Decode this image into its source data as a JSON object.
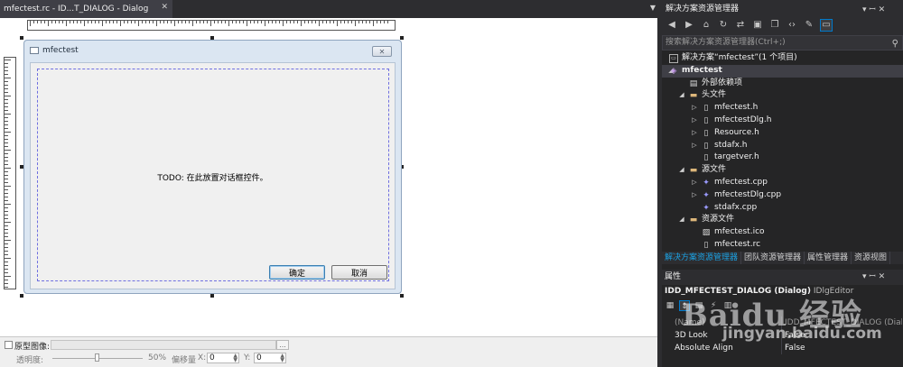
{
  "document": {
    "tab_title": "mfectest.rc - ID...T_DIALOG - Dialog",
    "close_glyph": "✕",
    "dropdown_glyph": "▼"
  },
  "dialog": {
    "title": "mfectest",
    "close_glyph": "✕",
    "todo_text": "TODO: 在此放置对话框控件。",
    "ok_label": "确定",
    "cancel_label": "取消"
  },
  "bottom_bar": {
    "prototype_label": "原型图像:",
    "browse_label": "...",
    "transparency_label": "透明度:",
    "transparency_value": "50%",
    "offset_label": "偏移量",
    "x_label": "X:",
    "x_value": "0",
    "y_label": "Y:",
    "y_value": "0"
  },
  "solution_explorer": {
    "title": "解决方案资源管理器",
    "pin_glyph": "▾ ꟷ ✕",
    "search_placeholder": "搜索解决方案资源管理器(Ctrl+;)",
    "search_icon": "search-icon",
    "toolbar_icons": [
      "back-icon",
      "forward-icon",
      "home-icon",
      "sync-icon",
      "refresh-icon",
      "collapse-all-icon",
      "show-all-files-icon",
      "code-view-icon",
      "properties-icon",
      "preview-icon"
    ],
    "tree": [
      {
        "label": "解决方案“mfectest”(1 个项目)",
        "icon": "solution-icon",
        "depth": 0,
        "expander": ""
      },
      {
        "label": "mfectest",
        "icon": "project-icon",
        "depth": 0,
        "expander": "◢",
        "bold": true,
        "selected": true
      },
      {
        "label": "外部依赖项",
        "icon": "external-deps-icon",
        "depth": 1,
        "expander": ""
      },
      {
        "label": "头文件",
        "icon": "folder-icon",
        "depth": 1,
        "expander": "◢"
      },
      {
        "label": "mfectest.h",
        "icon": "header-file-icon",
        "depth": 2,
        "expander": "▷"
      },
      {
        "label": "mfectestDlg.h",
        "icon": "header-file-icon",
        "depth": 2,
        "expander": "▷"
      },
      {
        "label": "Resource.h",
        "icon": "header-file-icon",
        "depth": 2,
        "expander": "▷"
      },
      {
        "label": "stdafx.h",
        "icon": "header-file-icon",
        "depth": 2,
        "expander": "▷"
      },
      {
        "label": "targetver.h",
        "icon": "header-file-icon",
        "depth": 2,
        "expander": ""
      },
      {
        "label": "源文件",
        "icon": "folder-icon",
        "depth": 1,
        "expander": "◢"
      },
      {
        "label": "mfectest.cpp",
        "icon": "cpp-file-icon",
        "depth": 2,
        "expander": "▷"
      },
      {
        "label": "mfectestDlg.cpp",
        "icon": "cpp-file-icon",
        "depth": 2,
        "expander": "▷"
      },
      {
        "label": "stdafx.cpp",
        "icon": "cpp-file-icon",
        "depth": 2,
        "expander": ""
      },
      {
        "label": "资源文件",
        "icon": "folder-icon",
        "depth": 1,
        "expander": "◢"
      },
      {
        "label": "mfectest.ico",
        "icon": "image-file-icon",
        "depth": 2,
        "expander": ""
      },
      {
        "label": "mfectest.rc",
        "icon": "resource-file-icon",
        "depth": 2,
        "expander": ""
      }
    ],
    "bottom_tabs": [
      "解决方案资源管理器",
      "团队资源管理器",
      "属性管理器",
      "资源视图"
    ],
    "active_tab_index": 0
  },
  "properties": {
    "title": "属性",
    "pin_glyph": "▾ ꟷ ✕",
    "object_name": "IDD_MFECTEST_DIALOG (Dialog)",
    "object_type": "IDlgEditor",
    "toolbar_icons": [
      "categorized-icon",
      "alphabetical-icon",
      "properties-page-icon",
      "events-icon",
      "property-pages-icon"
    ],
    "rows": [
      {
        "key": "(Name)",
        "value": "IDD_MFECTEST_DIALOG (Dialog)",
        "dim": true
      },
      {
        "key": "3D Look",
        "value": "False",
        "dim": false
      },
      {
        "key": "Absolute Align",
        "value": "False",
        "dim": false
      }
    ]
  },
  "watermark": {
    "logo_text": "Baidu 经验",
    "url": "jingyan.baidu.com"
  }
}
